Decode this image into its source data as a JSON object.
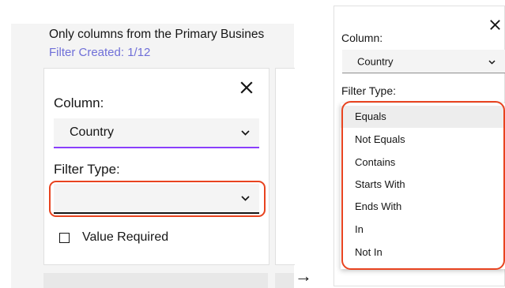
{
  "left": {
    "intro_text": "Only columns from the Primary Busines",
    "filter_created": "Filter Created: 1/12",
    "column_label": "Column:",
    "column_value": "Country",
    "filter_type_label": "Filter Type:",
    "filter_type_value": "",
    "value_required_label": "Value Required",
    "value_required_checked": false
  },
  "arrow": "→",
  "right": {
    "column_label": "Column:",
    "column_value": "Country",
    "filter_type_label": "Filter Type:",
    "options": [
      "Equals",
      "Not Equals",
      "Contains",
      "Starts With",
      "Ends With",
      "In",
      "Not In"
    ],
    "highlighted_option": "Equals"
  },
  "colors": {
    "highlight_ring": "#e8431f",
    "accent_link": "#6f6fd8",
    "focus_underline": "#8a3ffc"
  },
  "icons": {
    "close": "close-icon",
    "chevron": "chevron-down-icon",
    "checkbox": "checkbox-icon"
  }
}
